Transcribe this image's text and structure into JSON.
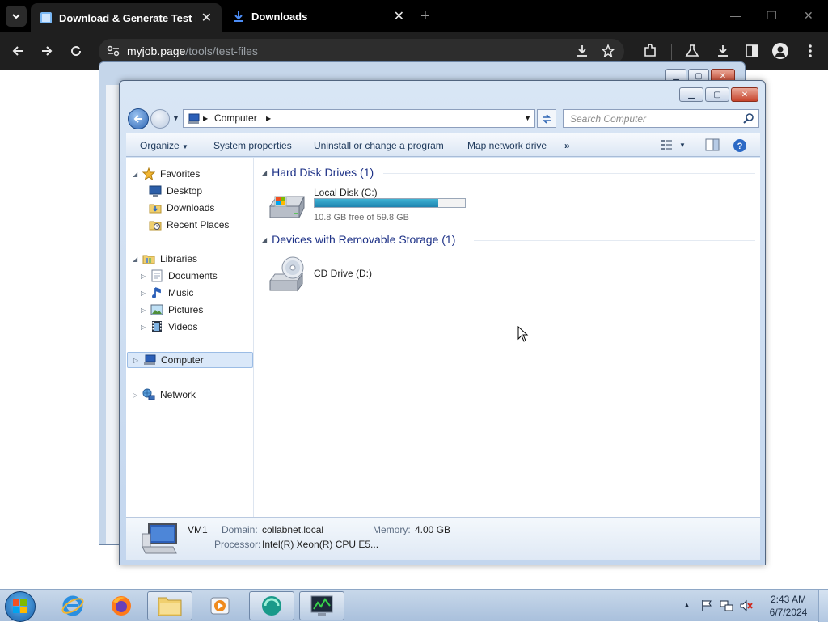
{
  "browser": {
    "tabs": [
      {
        "title": "Download & Generate Test File",
        "active": true
      },
      {
        "title": "Downloads",
        "active": false
      }
    ],
    "url_host": "myjob.page",
    "url_path": "/tools/test-files"
  },
  "explorer": {
    "breadcrumb": [
      "Computer"
    ],
    "search_placeholder": "Search Computer",
    "commands": [
      "Organize",
      "System properties",
      "Uninstall or change a program",
      "Map network drive",
      "»"
    ],
    "nav": {
      "favorites": {
        "label": "Favorites",
        "items": [
          "Desktop",
          "Downloads",
          "Recent Places"
        ]
      },
      "libraries": {
        "label": "Libraries",
        "items": [
          "Documents",
          "Music",
          "Pictures",
          "Videos"
        ]
      },
      "computer": "Computer",
      "network": "Network"
    },
    "groups": [
      {
        "title": "Hard Disk Drives (1)"
      },
      {
        "title": "Devices with Removable Storage (1)"
      }
    ],
    "drives": {
      "local": {
        "name": "Local Disk (C:)",
        "free": "10.8 GB free of 59.8 GB",
        "used_fraction": 0.82
      },
      "cd": {
        "name": "CD Drive (D:)"
      }
    },
    "details": {
      "name": "VM1",
      "domain_key": "Domain:",
      "domain_val": "collabnet.local",
      "memory_key": "Memory:",
      "memory_val": "4.00 GB",
      "processor_key": "Processor:",
      "processor_val": "Intel(R) Xeon(R) CPU E5..."
    }
  },
  "taskbar": {
    "time": "2:43 AM",
    "date": "6/7/2024"
  }
}
